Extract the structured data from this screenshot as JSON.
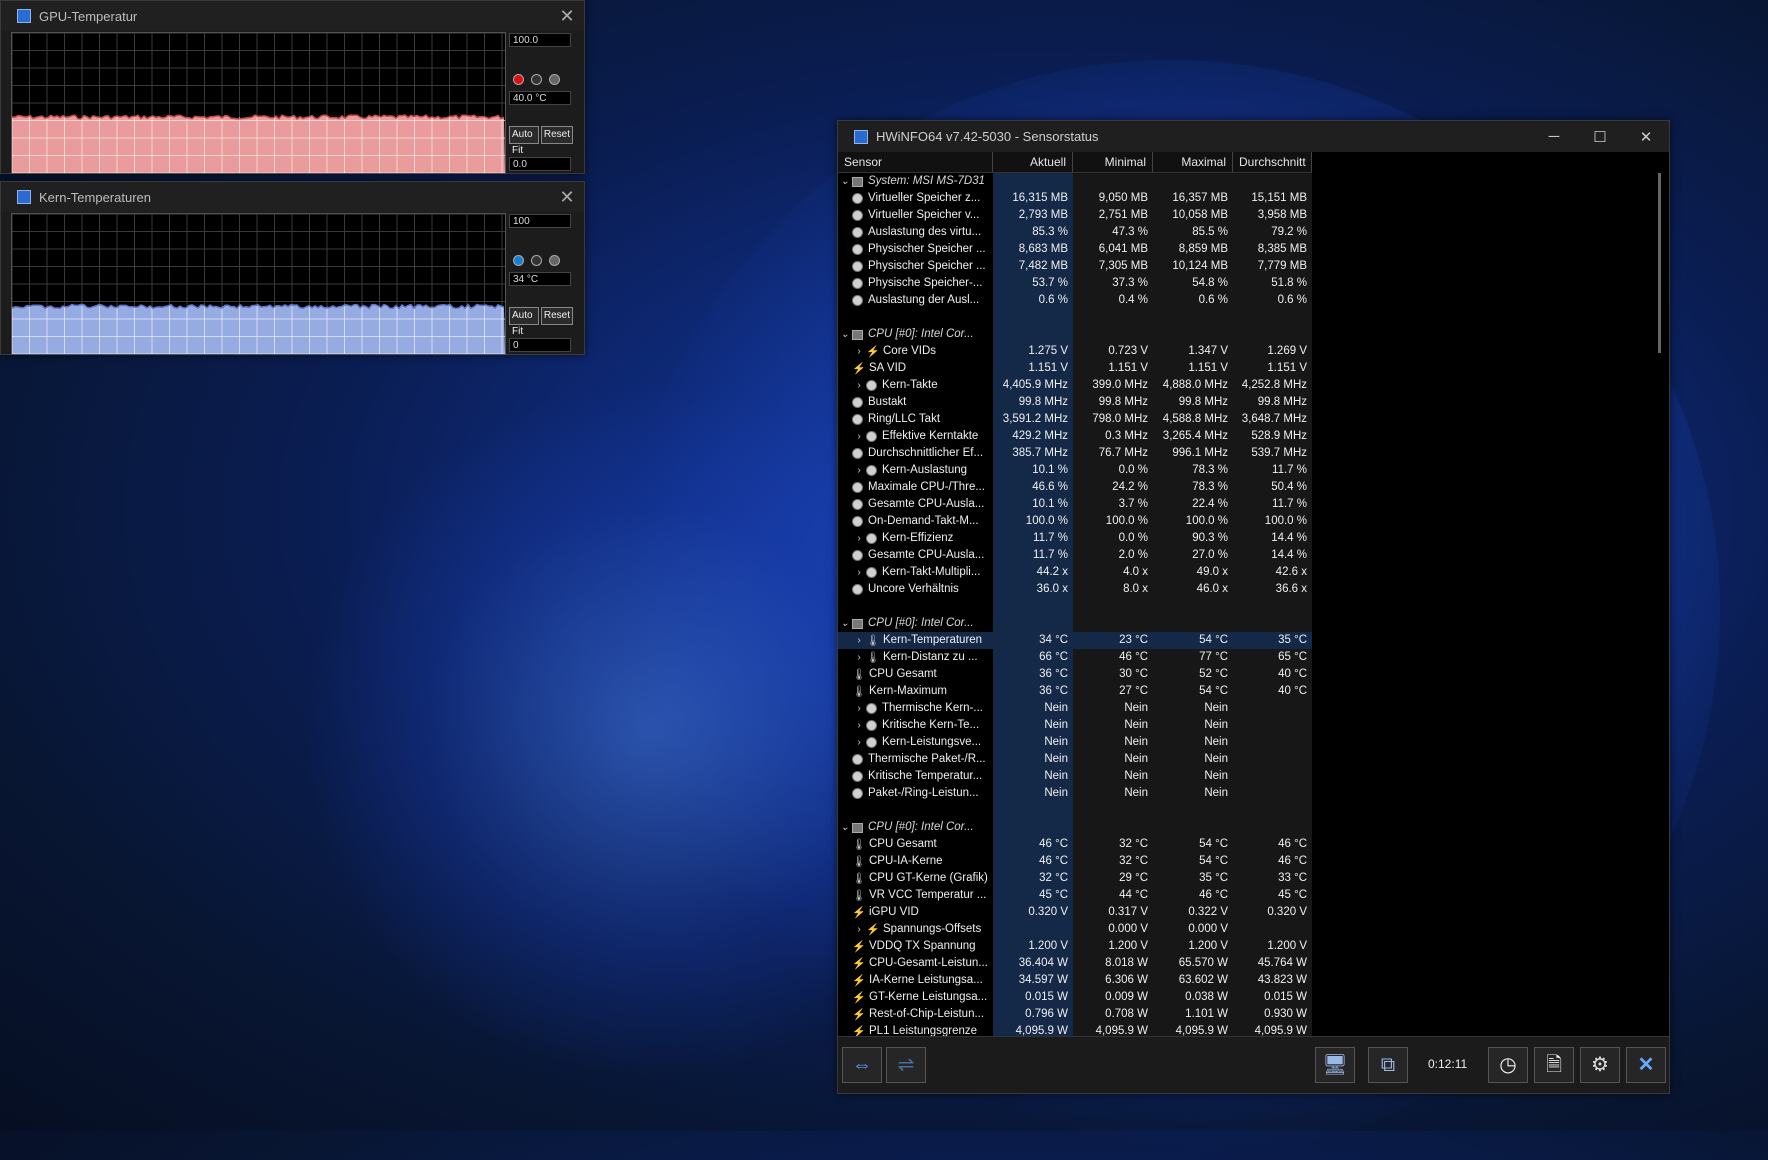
{
  "gpu_window": {
    "title": "GPU-Temperatur",
    "max_label": "100.0",
    "current_label": "40.0 °C",
    "min_label": "0.0",
    "autofit": "Auto Fit",
    "reset": "Reset",
    "fill_color": "#f7a3a3",
    "line_color": "#c44b4b",
    "level_percent": 40
  },
  "core_window": {
    "title": "Kern-Temperaturen",
    "max_label": "100",
    "current_label": "34 °C",
    "min_label": "0",
    "autofit": "Auto Fit",
    "reset": "Reset",
    "fill_color": "#9fb4ef",
    "line_color": "#5c75c9",
    "level_percent": 34
  },
  "hwinfo": {
    "title": "HWiNFO64 v7.42-5030 - Sensorstatus",
    "columns": [
      "Sensor",
      "Aktuell",
      "Minimal",
      "Maximal",
      "Durchschnitt"
    ],
    "rows": [
      {
        "type": "group",
        "label": "System: MSI MS-7D31"
      },
      {
        "icon": "mem",
        "label": "Virtueller Speicher z...",
        "v": [
          "16,315 MB",
          "9,050 MB",
          "16,357 MB",
          "15,151 MB"
        ]
      },
      {
        "icon": "mem",
        "label": "Virtueller Speicher v...",
        "v": [
          "2,793 MB",
          "2,751 MB",
          "10,058 MB",
          "3,958 MB"
        ]
      },
      {
        "icon": "mem",
        "label": "Auslastung des virtu...",
        "v": [
          "85.3 %",
          "47.3 %",
          "85.5 %",
          "79.2 %"
        ]
      },
      {
        "icon": "mem",
        "label": "Physischer Speicher ...",
        "v": [
          "8,683 MB",
          "6,041 MB",
          "8,859 MB",
          "8,385 MB"
        ]
      },
      {
        "icon": "mem",
        "label": "Physischer Speicher ...",
        "v": [
          "7,482 MB",
          "7,305 MB",
          "10,124 MB",
          "7,779 MB"
        ]
      },
      {
        "icon": "mem",
        "label": "Physische Speicher-...",
        "v": [
          "53.7 %",
          "37.3 %",
          "54.8 %",
          "51.8 %"
        ]
      },
      {
        "icon": "mem",
        "label": "Auslastung der Ausl...",
        "v": [
          "0.6 %",
          "0.4 %",
          "0.6 %",
          "0.6 %"
        ]
      },
      {
        "type": "blank"
      },
      {
        "type": "group",
        "label": "CPU [#0]: Intel Cor..."
      },
      {
        "icon": "volt",
        "expand": true,
        "label": "Core VIDs",
        "v": [
          "1.275 V",
          "0.723 V",
          "1.347 V",
          "1.269 V"
        ]
      },
      {
        "icon": "volt",
        "label": "SA VID",
        "v": [
          "1.151 V",
          "1.151 V",
          "1.151 V",
          "1.151 V"
        ]
      },
      {
        "icon": "mem",
        "expand": true,
        "label": "Kern-Takte",
        "v": [
          "4,405.9 MHz",
          "399.0 MHz",
          "4,888.0 MHz",
          "4,252.8 MHz"
        ]
      },
      {
        "icon": "mem",
        "label": "Bustakt",
        "v": [
          "99.8 MHz",
          "99.8 MHz",
          "99.8 MHz",
          "99.8 MHz"
        ]
      },
      {
        "icon": "mem",
        "label": "Ring/LLC Takt",
        "v": [
          "3,591.2 MHz",
          "798.0 MHz",
          "4,588.8 MHz",
          "3,648.7 MHz"
        ]
      },
      {
        "icon": "mem",
        "expand": true,
        "label": "Effektive Kerntakte",
        "v": [
          "429.2 MHz",
          "0.3 MHz",
          "3,265.4 MHz",
          "528.9 MHz"
        ]
      },
      {
        "icon": "mem",
        "label": "Durchschnittlicher Ef...",
        "v": [
          "385.7 MHz",
          "76.7 MHz",
          "996.1 MHz",
          "539.7 MHz"
        ]
      },
      {
        "icon": "mem",
        "expand": true,
        "label": "Kern-Auslastung",
        "v": [
          "10.1 %",
          "0.0 %",
          "78.3 %",
          "11.7 %"
        ]
      },
      {
        "icon": "mem",
        "label": "Maximale CPU-/Thre...",
        "v": [
          "46.6 %",
          "24.2 %",
          "78.3 %",
          "50.4 %"
        ]
      },
      {
        "icon": "mem",
        "label": "Gesamte CPU-Ausla...",
        "v": [
          "10.1 %",
          "3.7 %",
          "22.4 %",
          "11.7 %"
        ]
      },
      {
        "icon": "mem",
        "label": "On-Demand-Takt-M...",
        "v": [
          "100.0 %",
          "100.0 %",
          "100.0 %",
          "100.0 %"
        ]
      },
      {
        "icon": "mem",
        "expand": true,
        "label": "Kern-Effizienz",
        "v": [
          "11.7 %",
          "0.0 %",
          "90.3 %",
          "14.4 %"
        ]
      },
      {
        "icon": "mem",
        "label": "Gesamte CPU-Ausla...",
        "v": [
          "11.7 %",
          "2.0 %",
          "27.0 %",
          "14.4 %"
        ]
      },
      {
        "icon": "mem",
        "expand": true,
        "label": "Kern-Takt-Multipli...",
        "v": [
          "44.2 x",
          "4.0 x",
          "49.0 x",
          "42.6 x"
        ]
      },
      {
        "icon": "mem",
        "label": "Uncore Verhältnis",
        "v": [
          "36.0 x",
          "8.0 x",
          "46.0 x",
          "36.6 x"
        ]
      },
      {
        "type": "blank"
      },
      {
        "type": "group",
        "label": "CPU [#0]: Intel Cor..."
      },
      {
        "icon": "therm",
        "expand": true,
        "sel": true,
        "label": "Kern-Temperaturen",
        "v": [
          "34 °C",
          "23 °C",
          "54 °C",
          "35 °C"
        ]
      },
      {
        "icon": "therm",
        "expand": true,
        "label": "Kern-Distanz zu ...",
        "v": [
          "66 °C",
          "46 °C",
          "77 °C",
          "65 °C"
        ]
      },
      {
        "icon": "therm",
        "label": "CPU Gesamt",
        "v": [
          "36 °C",
          "30 °C",
          "52 °C",
          "40 °C"
        ]
      },
      {
        "icon": "therm",
        "label": "Kern-Maximum",
        "v": [
          "36 °C",
          "27 °C",
          "54 °C",
          "40 °C"
        ]
      },
      {
        "icon": "mem",
        "expand": true,
        "label": "Thermische Kern-...",
        "v": [
          "Nein",
          "Nein",
          "Nein",
          ""
        ]
      },
      {
        "icon": "mem",
        "expand": true,
        "label": "Kritische Kern-Te...",
        "v": [
          "Nein",
          "Nein",
          "Nein",
          ""
        ]
      },
      {
        "icon": "mem",
        "expand": true,
        "label": "Kern-Leistungsve...",
        "v": [
          "Nein",
          "Nein",
          "Nein",
          ""
        ]
      },
      {
        "icon": "mem",
        "label": "Thermische Paket-/R...",
        "v": [
          "Nein",
          "Nein",
          "Nein",
          ""
        ]
      },
      {
        "icon": "mem",
        "label": "Kritische Temperatur...",
        "v": [
          "Nein",
          "Nein",
          "Nein",
          ""
        ]
      },
      {
        "icon": "mem",
        "label": "Paket-/Ring-Leistun...",
        "v": [
          "Nein",
          "Nein",
          "Nein",
          ""
        ]
      },
      {
        "type": "blank"
      },
      {
        "type": "group",
        "label": "CPU [#0]: Intel Cor..."
      },
      {
        "icon": "therm",
        "label": "CPU Gesamt",
        "v": [
          "46 °C",
          "32 °C",
          "54 °C",
          "46 °C"
        ]
      },
      {
        "icon": "therm",
        "label": "CPU-IA-Kerne",
        "v": [
          "46 °C",
          "32 °C",
          "54 °C",
          "46 °C"
        ]
      },
      {
        "icon": "therm",
        "label": "CPU GT-Kerne (Grafik)",
        "v": [
          "32 °C",
          "29 °C",
          "35 °C",
          "33 °C"
        ]
      },
      {
        "icon": "therm",
        "label": "VR VCC Temperatur ...",
        "v": [
          "45 °C",
          "44 °C",
          "46 °C",
          "45 °C"
        ]
      },
      {
        "icon": "volt",
        "label": "iGPU VID",
        "v": [
          "0.320 V",
          "0.317 V",
          "0.322 V",
          "0.320 V"
        ]
      },
      {
        "icon": "volt",
        "expand": true,
        "label": "Spannungs-Offsets",
        "v": [
          "",
          "0.000 V",
          "0.000 V",
          ""
        ]
      },
      {
        "icon": "volt",
        "label": "VDDQ TX Spannung",
        "v": [
          "1.200 V",
          "1.200 V",
          "1.200 V",
          "1.200 V"
        ]
      },
      {
        "icon": "volt",
        "label": "CPU-Gesamt-Leistun...",
        "v": [
          "36.404 W",
          "8.018 W",
          "65.570 W",
          "45.764 W"
        ]
      },
      {
        "icon": "volt",
        "label": "IA-Kerne Leistungsa...",
        "v": [
          "34.597 W",
          "6.306 W",
          "63.602 W",
          "43.823 W"
        ]
      },
      {
        "icon": "volt",
        "label": "GT-Kerne Leistungsa...",
        "v": [
          "0.015 W",
          "0.009 W",
          "0.038 W",
          "0.015 W"
        ]
      },
      {
        "icon": "volt",
        "label": "Rest-of-Chip-Leistun...",
        "v": [
          "0.796 W",
          "0.708 W",
          "1.101 W",
          "0.930 W"
        ]
      },
      {
        "icon": "volt",
        "label": "PL1 Leistungsgrenze",
        "v": [
          "4,095.9 W",
          "4,095.9 W",
          "4,095.9 W",
          "4,095.9 W"
        ]
      }
    ],
    "timer": "0:12:11"
  }
}
